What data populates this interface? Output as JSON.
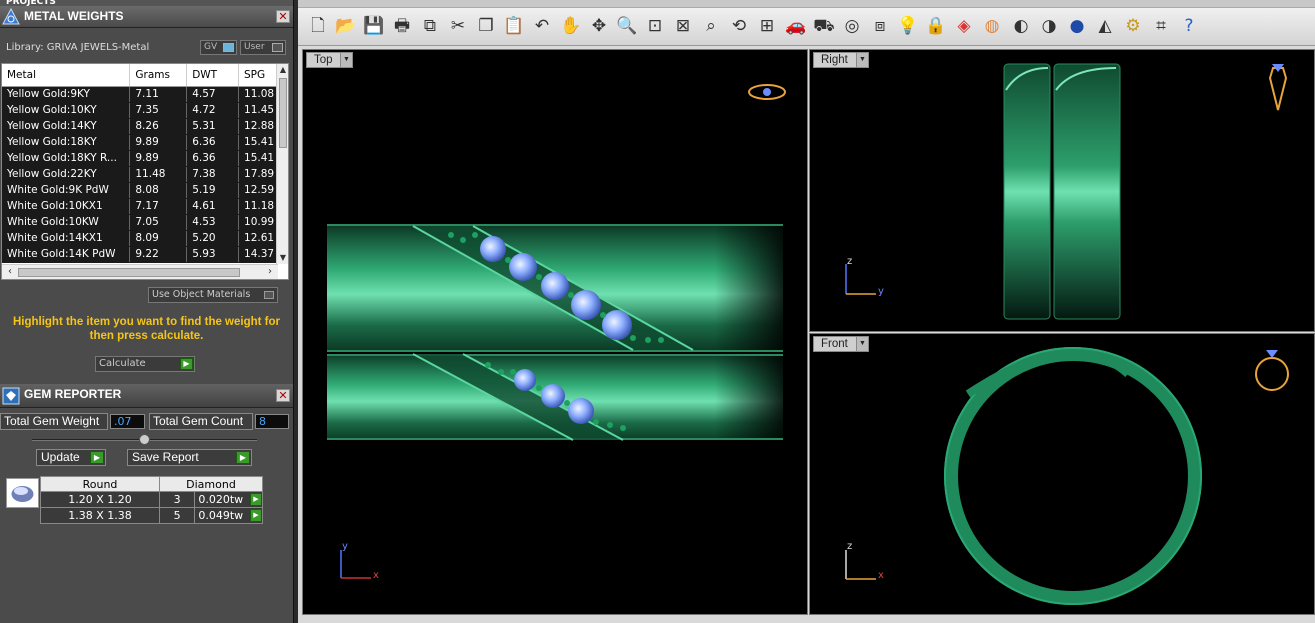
{
  "projects_label": "PROJECTS",
  "metal_weights": {
    "title": "METAL WEIGHTS",
    "library": "Library: GRIVA JEWELS-Metal",
    "gv_label": "GV",
    "user_label": "User",
    "columns": [
      "Metal",
      "Grams",
      "DWT",
      "SPG"
    ],
    "rows": [
      [
        "Yellow Gold:9KY",
        "7.11",
        "4.57",
        "11.08"
      ],
      [
        "Yellow Gold:10KY",
        "7.35",
        "4.72",
        "11.45"
      ],
      [
        "Yellow Gold:14KY",
        "8.26",
        "5.31",
        "12.88"
      ],
      [
        "Yellow Gold:18KY",
        "9.89",
        "6.36",
        "15.41"
      ],
      [
        "Yellow Gold:18KY R...",
        "9.89",
        "6.36",
        "15.41"
      ],
      [
        "Yellow Gold:22KY",
        "11.48",
        "7.38",
        "17.89"
      ],
      [
        "White Gold:9K PdW",
        "8.08",
        "5.19",
        "12.59"
      ],
      [
        "White Gold:10KX1",
        "7.17",
        "4.61",
        "11.18"
      ],
      [
        "White Gold:10KW",
        "7.05",
        "4.53",
        "10.99"
      ],
      [
        "White Gold:14KX1",
        "8.09",
        "5.20",
        "12.61"
      ],
      [
        "White Gold:14K PdW",
        "9.22",
        "5.93",
        "14.37"
      ]
    ],
    "use_object_materials": "Use Object Materials",
    "hint": "Highlight the item you want to find the weight for then press calculate.",
    "calculate_label": "Calculate"
  },
  "gem_reporter": {
    "title": "GEM REPORTER",
    "total_weight_label": "Total Gem Weight",
    "total_weight_value": ".07",
    "total_count_label": "Total Gem Count",
    "total_count_value": "8",
    "update_label": "Update",
    "save_report_label": "Save Report",
    "headers": [
      "Round",
      "Diamond"
    ],
    "rows": [
      {
        "size": "1.20 X 1.20",
        "count": "3",
        "weight": "0.020tw"
      },
      {
        "size": "1.38 X 1.38",
        "count": "5",
        "weight": "0.049tw"
      }
    ]
  },
  "viewports": {
    "top": "Top",
    "right": "Right",
    "front": "Front"
  },
  "axes": {
    "top_v": "y",
    "top_h": "x",
    "right_v": "z",
    "right_h": "y",
    "front_v": "z",
    "front_h": "x"
  },
  "toolbar_icons": [
    "new-icon",
    "open-icon",
    "save-icon",
    "print-icon",
    "copy-doc-icon",
    "cut-icon",
    "copy-icon",
    "paste-icon",
    "undo-icon",
    "pan-icon",
    "rotate-view-icon",
    "zoom-icon",
    "zoom-window-icon",
    "zoom-extents-icon",
    "zoom-selected-icon",
    "rotate-icon",
    "four-views-icon",
    "car-icon",
    "car-outline-icon",
    "target-icon",
    "snap-icon",
    "bulb-icon",
    "lock-icon",
    "layers-icon",
    "color-wheel-icon",
    "shade-icon",
    "render-icon",
    "sphere-icon",
    "spotlight-icon",
    "settings-icon",
    "crop-icon",
    "help-icon"
  ],
  "colors": {
    "metal_green": "#1f8a5c",
    "gem_blue": "#7fa9ff",
    "hint_yellow": "#f5c518"
  }
}
